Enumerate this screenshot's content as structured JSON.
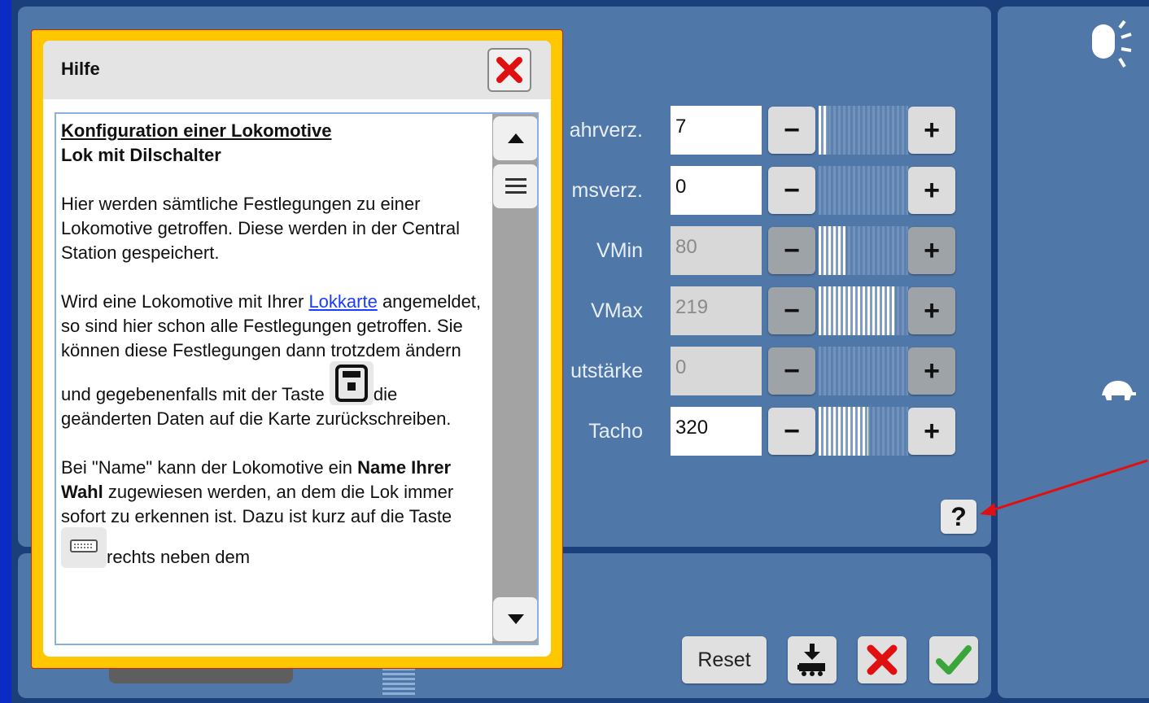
{
  "help_dialog": {
    "title": "Hilfe",
    "heading": "Konfiguration einer Lokomotive ",
    "subheading": "Lok mit Dilschalter",
    "para1": "Hier werden sämtliche Festlegungen zu einer Lokomotive getroffen. Diese werden in der Central Station gespeichert.",
    "para2_a": "Wird eine Lokomotive mit Ihrer ",
    "para2_link": "Lokkarte",
    "para2_b": " angemeldet, so sind hier schon alle Festlegungen getroffen. Sie können diese Festlegungen dann trotzdem ändern und gegebenenfalls mit der Taste ",
    "para2_c": "die geänderten Daten auf die Karte zurückschreiben.",
    "para3_a": "Bei \"Name\" kann der Lokomotive ein ",
    "para3_bold": "Name Ihrer Wahl",
    "para3_b": " zugewiesen werden, an dem die Lok immer sofort zu erkennen ist. Dazu ist kurz auf die Taste ",
    "para3_c": "rechts neben dem"
  },
  "settings": [
    {
      "label": "ahrverz.",
      "value": "7",
      "enabled": true,
      "level": 0.1
    },
    {
      "label": "msverz.",
      "value": "0",
      "enabled": true,
      "level": 0.0
    },
    {
      "label": "VMin",
      "value": "80",
      "enabled": false,
      "level": 0.3
    },
    {
      "label": "VMax",
      "value": "219",
      "enabled": false,
      "level": 0.85
    },
    {
      "label": "utstärke",
      "value": "0",
      "enabled": false,
      "level": 0.0
    },
    {
      "label": "Tacho",
      "value": "320",
      "enabled": true,
      "level": 0.55
    }
  ],
  "buttons": {
    "minus": "−",
    "plus": "+",
    "help": "?",
    "reset": "Reset"
  },
  "icons": {
    "close": "close-x-icon",
    "brightness": "brightness-icon",
    "turtle": "turtle-icon",
    "card_write": "card-write-icon",
    "keyboard": "keyboard-icon",
    "save": "loco-save-icon",
    "cancel": "cancel-x-icon",
    "ok": "checkmark-icon"
  },
  "colors": {
    "panel": "#4f77a8",
    "dialog_border": "#ffc700",
    "link": "#1a3cff",
    "cancel_red": "#e01010",
    "ok_green": "#3aa63a"
  }
}
